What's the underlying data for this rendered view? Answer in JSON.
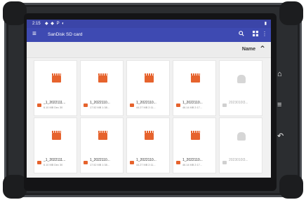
{
  "status_bar": {
    "time": "2:15",
    "icons": "◆ ◆ P ◐",
    "right": "▮"
  },
  "app_bar": {
    "title": "SanDisk SD card",
    "menu_icon": "menu-icon",
    "actions": [
      "search-icon",
      "grid-view-icon",
      "overflow-icon"
    ]
  },
  "sort": {
    "label": "Name",
    "direction": "ascending"
  },
  "files": [
    {
      "name": "_1_2022111...",
      "meta": "6.10 MB Dec 30",
      "type": "video"
    },
    {
      "name": "1_2022110...",
      "meta": "17.52 MB 1:38...",
      "type": "video"
    },
    {
      "name": "1_2022110...",
      "meta": "44.27 MB 2:11...",
      "type": "video"
    },
    {
      "name": "1_2022110...",
      "meta": "46.14 MB 2:17...",
      "type": "video"
    },
    {
      "name": "2023010l3...",
      "meta": "",
      "type": "android"
    },
    {
      "name": "_1_2022111...",
      "meta": "6.10 MB Dec 30",
      "type": "video"
    },
    {
      "name": "1_2022110...",
      "meta": "17.52 MB 1:38...",
      "type": "video"
    },
    {
      "name": "1_2022110...",
      "meta": "44.27 MB 2:11...",
      "type": "video"
    },
    {
      "name": "1_2022110...",
      "meta": "46.14 MB 2:17...",
      "type": "video"
    },
    {
      "name": "2023010l3...",
      "meta": "",
      "type": "android"
    }
  ],
  "nav_keys": {
    "home": "⌂",
    "menu": "≡",
    "back": "↶"
  },
  "colors": {
    "primary": "#3e4ab2",
    "status": "#3b45a8",
    "accent": "#e6632d"
  }
}
